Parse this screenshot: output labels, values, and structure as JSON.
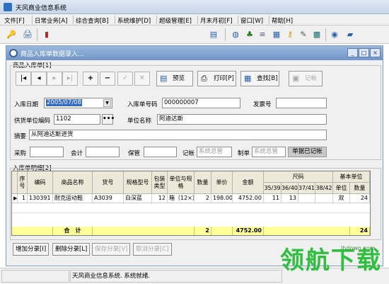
{
  "app": {
    "title": "天风商业信息系统"
  },
  "menu": [
    "文件[F]",
    "日常业务[A]",
    "综合查询[B]",
    "系统维护[D]",
    "超级管理[E]",
    "月末月初[F]",
    "窗口[W]",
    "帮助[H]"
  ],
  "child": {
    "title": "商品入库单数据录入..."
  },
  "group1": {
    "label": "商品入库单[1]"
  },
  "buttons": {
    "preview": "预览",
    "print": "打印[P]",
    "find": "查找[B]",
    "post": "记帐"
  },
  "form": {
    "date_label": "入库日期",
    "date_value": "2005/07/08",
    "no_label": "入库单号码",
    "no_value": "000000007",
    "invoice_label": "发票号",
    "invoice_value": "",
    "supplier_code_label": "供货单位编码",
    "supplier_code_value": "1102",
    "unit_name_label": "单位名称",
    "unit_name_value": "阿迪达斯",
    "summary_label": "摘要",
    "summary_value": "从阿迪达斯进货",
    "buyer_label": "采购",
    "accountant_label": "会计",
    "keeper_label": "保管",
    "bookkeeper_label": "记帐",
    "bookkeeper_value": "系统总管",
    "maker_label": "制单",
    "maker_value": "系统总管",
    "posted_label": "单据已记帐"
  },
  "group2": {
    "label": "入库单明细[2]"
  },
  "table": {
    "headers": {
      "seq": "序号",
      "code": "编码",
      "name": "商品名称",
      "item_no": "货号",
      "spec": "规格型号",
      "pack": "包装类型",
      "unit_spec": "单位与规格",
      "qty": "数量",
      "price": "单价",
      "amount": "金额",
      "size": "尺码",
      "s1": "35/39",
      "s2": "36/40",
      "s3": "37/41",
      "s4": "38/42",
      "base": "基本单位",
      "b_unit": "单位",
      "b_qty": "数量"
    },
    "row": {
      "seq": "1",
      "code": "130391",
      "name": "耐克运动鞋",
      "item_no": "A3039",
      "spec": "白深蓝",
      "pack": "12",
      "unit_spec": "箱（12×）",
      "qty": "2",
      "price": "198.00",
      "amount": "4752.00",
      "s1": "11",
      "s2": "13",
      "b_unit": "双",
      "b_qty": "24"
    },
    "total": {
      "label": "合　计",
      "qty": "2",
      "amount": "4752.00",
      "b_qty": "24"
    }
  },
  "bottom_buttons": {
    "add": "增加分录[I]",
    "delete": "删除分录[L]",
    "save": "保存分录[V]",
    "cancel": "取消分录[C]"
  },
  "status": {
    "text": "天风商业信息系统. 系统就绪."
  },
  "watermark": {
    "text": "领航下载",
    "site": "lhdown.com"
  },
  "colors": {
    "accent": "#3169c6",
    "total_row": "#ffff9a",
    "watermark": "#2fbf3f"
  }
}
